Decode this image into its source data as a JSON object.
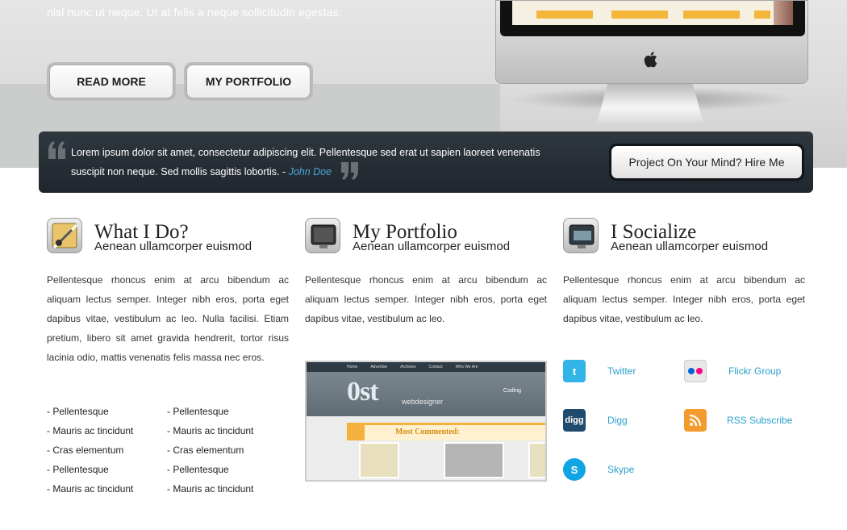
{
  "hero": {
    "text": "nisl nunc ut neque. Ut at felis a neque sollicitudin egestas.",
    "read_more": "READ MORE",
    "my_portfolio": "MY PORTFOLIO"
  },
  "quote": {
    "line1": "Lorem ipsum dolor sit amet, consectetur adipiscing elit. Pellentesque sed erat ut sapien laoreet venenatis",
    "line2": "suscipit non neque. Sed mollis sagittis lobortis. - ",
    "author": "John Doe",
    "hire_button": "Project On Your Mind? Hire Me"
  },
  "columns": [
    {
      "title": "What I Do?",
      "subtitle": "Aenean ullamcorper euismod",
      "body": "Pellentesque rhoncus enim at arcu bibendum ac aliquam lectus semper. Integer nibh eros, porta eget dapibus vitae, vestibulum ac leo. Nulla facilisi. Etiam pretium, libero sit amet gravida hendrerit, tortor risus lacinia odio, mattis venenatis felis massa nec eros."
    },
    {
      "title": "My Portfolio",
      "subtitle": "Aenean ullamcorper euismod",
      "body": "Pellentesque rhoncus enim at arcu bibendum ac aliquam lectus semper. Integer nibh eros, porta eget dapibus vitae, vestibulum ac leo."
    },
    {
      "title": "I Socialize",
      "subtitle": "Aenean ullamcorper euismod",
      "body": "Pellentesque rhoncus enim at arcu bibendum ac aliquam lectus semper. Integer nibh eros, porta eget dapibus vitae, vestibulum ac leo."
    }
  ],
  "list_a": [
    "- Pellentesque",
    "- Mauris ac tincidunt",
    "- Cras elementum",
    "- Pellentesque",
    "- Mauris ac tincidunt"
  ],
  "list_b": [
    "- Pellentesque",
    "- Mauris ac tincidunt",
    "- Cras elementum",
    "- Pellentesque",
    "- Mauris ac tincidunt"
  ],
  "portfolio_shot": {
    "nav": [
      "Home",
      "Advertise",
      "Archives",
      "Contact",
      "Who We Are"
    ],
    "logo": "0st",
    "logo_sub": "webdesigner",
    "coding": "Coding",
    "most_commented": "Most Commented:"
  },
  "social": {
    "twitter": "Twitter",
    "flickr": "Flickr Group",
    "digg": "Digg",
    "rss": "RSS Subscribe",
    "skype": "Skype"
  },
  "colors": {
    "link": "#2aa1cc",
    "quote_bg": "#262e35",
    "accent_orange": "#f5b13e"
  }
}
